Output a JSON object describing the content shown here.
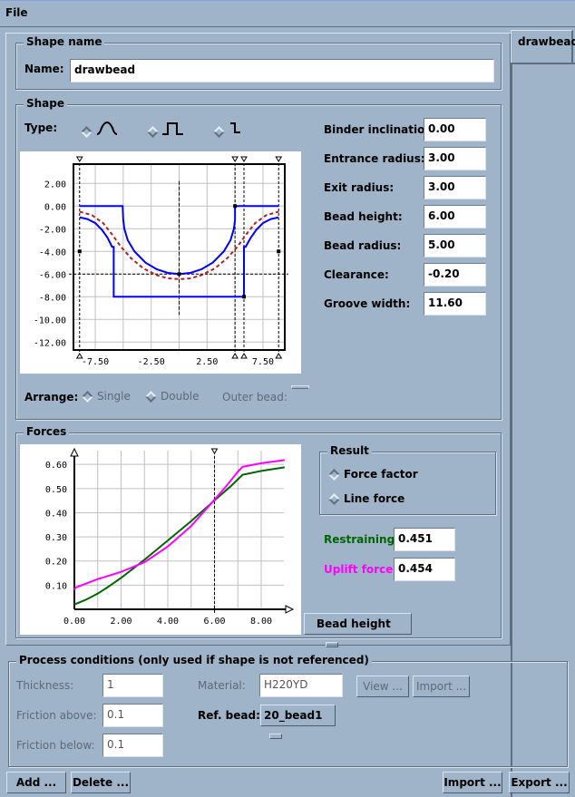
{
  "menu": {
    "file": "File"
  },
  "tab": {
    "label": "drawbead"
  },
  "shape_name": {
    "legend": "Shape name",
    "name_label": "Name:",
    "name_value": "drawbead"
  },
  "shape": {
    "legend": "Shape",
    "type_label": "Type:",
    "type_options": [
      {
        "icon": "round-bead-icon",
        "selected": true
      },
      {
        "icon": "square-bead-icon",
        "selected": false
      },
      {
        "icon": "step-bead-icon",
        "selected": false
      }
    ],
    "params": [
      {
        "label": "Binder inclination:",
        "value": "0.00"
      },
      {
        "label": "Entrance radius:",
        "value": "3.00"
      },
      {
        "label": "Exit radius:",
        "value": "3.00"
      },
      {
        "label": "Bead height:",
        "value": "6.00"
      },
      {
        "label": "Bead radius:",
        "value": "5.00"
      },
      {
        "label": "Clearance:",
        "value": "-0.20"
      },
      {
        "label": "Groove width:",
        "value": "11.60"
      }
    ],
    "arrange_label": "Arrange:",
    "arrange_single": "Single",
    "arrange_double": "Double",
    "outer_bead_label": "Outer bead:"
  },
  "forces": {
    "legend": "Forces",
    "result_legend": "Result",
    "force_factor": "Force factor",
    "line_force": "Line force",
    "restraining_label": "Restraining:",
    "restraining_value": "0.451",
    "uplift_label": "Uplift force:",
    "uplift_value": "0.454",
    "x_selector": "Bead height",
    "colors": {
      "restraining": "#006400",
      "uplift": "#ff00ff"
    }
  },
  "process": {
    "legend": "Process conditions (only used if shape is not referenced)",
    "thickness_label": "Thickness:",
    "thickness_value": "1",
    "friction_above_label": "Friction above:",
    "friction_above_value": "0.1",
    "friction_below_label": "Friction below:",
    "friction_below_value": "0.1",
    "material_label": "Material:",
    "material_value": "H220YD",
    "view_button": "View ...",
    "import_button": "Import ...",
    "ref_bead_label": "Ref. bead:",
    "ref_bead_value": "20_bead1"
  },
  "footer": {
    "add": "Add ...",
    "delete": "Delete ...",
    "import": "Import ...",
    "export": "Export ..."
  },
  "chart_data": [
    {
      "type": "line",
      "xlim": [
        -9.45,
        9.45
      ],
      "ylim": [
        -12.7,
        3.7
      ],
      "xticks": [
        "-7.50",
        "-2.50",
        "2.50",
        "7.50"
      ],
      "xtick_values": [
        -7.5,
        -2.5,
        2.5,
        7.5
      ],
      "yticks": [
        "2.00",
        "0.00",
        "-2.00",
        "-4.00",
        "-6.00",
        "-8.00",
        "-10.00",
        "-12.00"
      ],
      "ytick_values": [
        2,
        0,
        -2,
        -4,
        -6,
        -8,
        -10,
        -12
      ],
      "grid": true,
      "series": [
        {
          "color": "#0000ff",
          "style": "solid",
          "points": [
            [
              -8.9,
              0
            ],
            [
              -5.05,
              0
            ],
            [
              -5.0,
              -1.2
            ],
            [
              -4.9,
              -2.0
            ],
            [
              -4.6,
              -3.0
            ],
            [
              -4.0,
              -4.0
            ],
            [
              -3.0,
              -5.0
            ],
            [
              -2.0,
              -5.58
            ],
            [
              -1.0,
              -5.9
            ],
            [
              0,
              -6
            ],
            [
              1.0,
              -5.9
            ],
            [
              2.0,
              -5.58
            ],
            [
              3.0,
              -5.0
            ],
            [
              4.0,
              -4.0
            ],
            [
              4.6,
              -3.0
            ],
            [
              4.9,
              -2.0
            ],
            [
              5.0,
              -1.2
            ],
            [
              5.0,
              0
            ],
            [
              8.9,
              0
            ]
          ]
        },
        {
          "color": "#0000ff",
          "style": "solid",
          "points": [
            [
              -8.9,
              -1
            ],
            [
              -8.2,
              -1.15
            ],
            [
              -7.5,
              -1.5
            ],
            [
              -6.9,
              -2.1
            ],
            [
              -6.4,
              -2.8
            ],
            [
              -6.0,
              -3.6
            ],
            [
              -5.85,
              -3.6
            ],
            [
              -5.85,
              -8
            ],
            [
              5.8,
              -8
            ],
            [
              5.8,
              -3.6
            ],
            [
              5.95,
              -3.6
            ],
            [
              6.4,
              -2.8
            ],
            [
              6.9,
              -2.1
            ],
            [
              7.5,
              -1.5
            ],
            [
              8.2,
              -1.15
            ],
            [
              8.9,
              -1
            ]
          ]
        },
        {
          "color": "#b22222",
          "style": "dashed",
          "points": [
            [
              -8.9,
              -0.5
            ],
            [
              -7.8,
              -0.8
            ],
            [
              -6.8,
              -1.5
            ],
            [
              -6.0,
              -2.5
            ],
            [
              -5.2,
              -3.6
            ],
            [
              -4.3,
              -4.6
            ],
            [
              -3.2,
              -5.5
            ],
            [
              -2.0,
              -6.1
            ],
            [
              -1.0,
              -6.38
            ],
            [
              0,
              -6.45
            ],
            [
              1.0,
              -6.38
            ],
            [
              2.0,
              -6.1
            ],
            [
              3.2,
              -5.5
            ],
            [
              4.3,
              -4.6
            ],
            [
              5.2,
              -3.6
            ],
            [
              6.0,
              -2.5
            ],
            [
              6.8,
              -1.5
            ],
            [
              7.8,
              -0.8
            ],
            [
              8.9,
              -0.5
            ]
          ]
        }
      ]
    },
    {
      "type": "line",
      "xlim": [
        0,
        8.97
      ],
      "ylim": [
        0,
        0.657
      ],
      "xticks": [
        "0.00",
        "2.00",
        "4.00",
        "6.00",
        "8.00"
      ],
      "xtick_values": [
        0,
        2,
        4,
        6,
        8
      ],
      "yticks": [
        "0.60",
        "0.50",
        "0.40",
        "0.30",
        "0.20",
        "0.10"
      ],
      "ytick_values": [
        0.6,
        0.5,
        0.4,
        0.3,
        0.2,
        0.1
      ],
      "grid": true,
      "marker_x": 6.0,
      "series": [
        {
          "color": "#006400",
          "points": [
            [
              0,
              0.02
            ],
            [
              0.5,
              0.04
            ],
            [
              1,
              0.065
            ],
            [
              1.4,
              0.09
            ],
            [
              2,
              0.13
            ],
            [
              3,
              0.205
            ],
            [
              4,
              0.285
            ],
            [
              5,
              0.365
            ],
            [
              6,
              0.451
            ],
            [
              6.7,
              0.51
            ],
            [
              7.2,
              0.557
            ],
            [
              8,
              0.573
            ],
            [
              9,
              0.588
            ]
          ]
        },
        {
          "color": "#ff00ff",
          "points": [
            [
              0,
              0.08
            ],
            [
              0.05,
              0.09
            ],
            [
              1,
              0.125
            ],
            [
              1.5,
              0.14
            ],
            [
              2,
              0.155
            ],
            [
              2.5,
              0.175
            ],
            [
              3,
              0.195
            ],
            [
              4,
              0.26
            ],
            [
              5,
              0.345
            ],
            [
              6,
              0.454
            ],
            [
              6.5,
              0.51
            ],
            [
              7,
              0.57
            ],
            [
              7.2,
              0.59
            ],
            [
              8,
              0.605
            ],
            [
              9,
              0.618
            ]
          ]
        }
      ]
    }
  ]
}
